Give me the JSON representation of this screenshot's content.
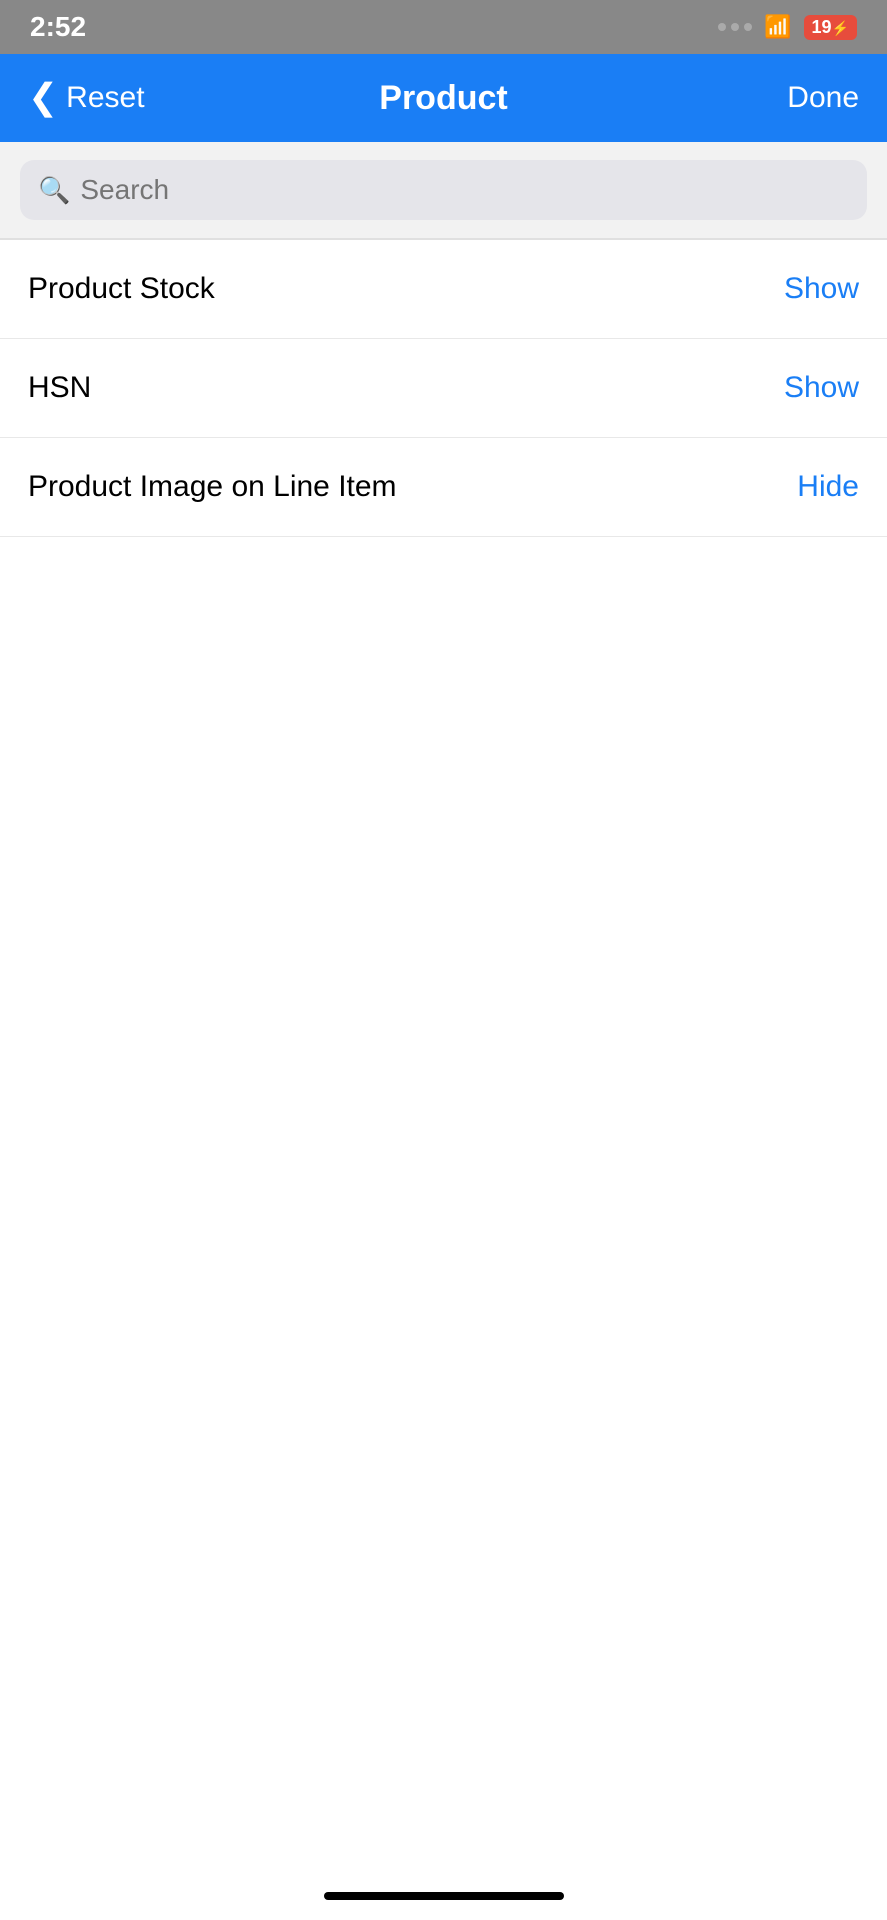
{
  "statusBar": {
    "time": "2:52",
    "batteryLabel": "19"
  },
  "navBar": {
    "backLabel": "Reset",
    "title": "Product",
    "doneLabel": "Done"
  },
  "search": {
    "placeholder": "Search"
  },
  "settingsItems": [
    {
      "label": "Product Stock",
      "action": "Show"
    },
    {
      "label": "HSN",
      "action": "Show"
    },
    {
      "label": "Product Image on Line Item",
      "action": "Hide"
    }
  ]
}
